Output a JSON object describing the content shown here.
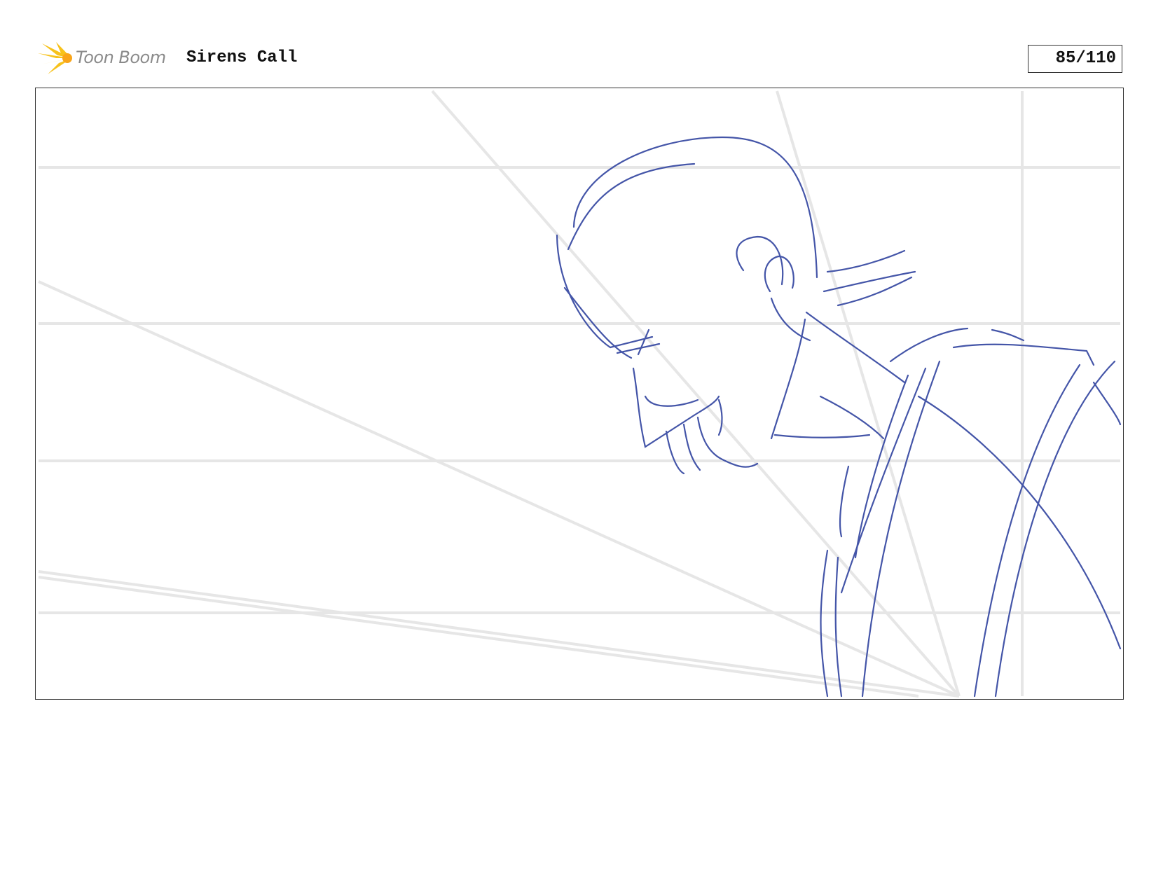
{
  "header": {
    "logo_text": "Toon Boom",
    "project_title": "Sirens Call",
    "page_counter": "85/110"
  },
  "panel": {
    "sketch_color": "#4455a8",
    "guide_color": "#e6e6e6"
  },
  "icons": {
    "logo": "toon-boom-burst-icon"
  }
}
